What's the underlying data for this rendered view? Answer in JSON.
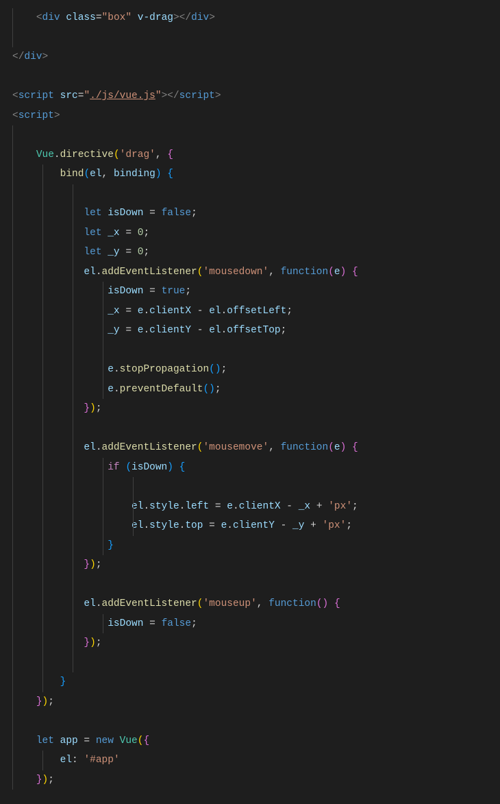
{
  "code": {
    "lines": [
      {
        "indent": 4,
        "guides": [
          0
        ],
        "tokens": [
          [
            "t-punct",
            "<"
          ],
          [
            "t-tag",
            "div"
          ],
          [
            "t-op",
            " "
          ],
          [
            "t-attr",
            "class"
          ],
          [
            "t-op",
            "="
          ],
          [
            "t-string",
            "\"box\""
          ],
          [
            "t-op",
            " "
          ],
          [
            "t-attr",
            "v-drag"
          ],
          [
            "t-punct",
            "></"
          ],
          [
            "t-tag",
            "div"
          ],
          [
            "t-punct",
            ">"
          ]
        ]
      },
      {
        "indent": 0,
        "guides": [
          0
        ],
        "tokens": []
      },
      {
        "indent": 0,
        "guides": [],
        "tokens": [
          [
            "t-punct",
            "</"
          ],
          [
            "t-tag",
            "div"
          ],
          [
            "t-punct",
            ">"
          ]
        ]
      },
      {
        "indent": 0,
        "guides": [],
        "tokens": []
      },
      {
        "indent": 0,
        "guides": [],
        "tokens": [
          [
            "t-punct",
            "<"
          ],
          [
            "t-tag",
            "script"
          ],
          [
            "t-op",
            " "
          ],
          [
            "t-attr",
            "src"
          ],
          [
            "t-op",
            "="
          ],
          [
            "t-string",
            "\""
          ],
          [
            "t-string-u",
            "./js/vue.js"
          ],
          [
            "t-string",
            "\""
          ],
          [
            "t-punct",
            "></"
          ],
          [
            "t-tag",
            "script"
          ],
          [
            "t-punct",
            ">"
          ]
        ]
      },
      {
        "indent": 0,
        "guides": [],
        "tokens": [
          [
            "t-punct",
            "<"
          ],
          [
            "t-tag",
            "script"
          ],
          [
            "t-punct",
            ">"
          ]
        ]
      },
      {
        "indent": 0,
        "guides": [
          0
        ],
        "tokens": []
      },
      {
        "indent": 4,
        "guides": [
          0
        ],
        "tokens": [
          [
            "t-obj",
            "Vue"
          ],
          [
            "t-op",
            "."
          ],
          [
            "t-func",
            "directive"
          ],
          [
            "t-brace-y",
            "("
          ],
          [
            "t-string",
            "'drag'"
          ],
          [
            "t-op",
            ", "
          ],
          [
            "t-brace-p",
            "{"
          ]
        ]
      },
      {
        "indent": 8,
        "guides": [
          0,
          4
        ],
        "tokens": [
          [
            "t-func",
            "bind"
          ],
          [
            "t-brace-b",
            "("
          ],
          [
            "t-var",
            "el"
          ],
          [
            "t-op",
            ", "
          ],
          [
            "t-var",
            "binding"
          ],
          [
            "t-brace-b",
            ")"
          ],
          [
            "t-op",
            " "
          ],
          [
            "t-brace-b",
            "{"
          ]
        ]
      },
      {
        "indent": 0,
        "guides": [
          0,
          4,
          8
        ],
        "tokens": []
      },
      {
        "indent": 12,
        "guides": [
          0,
          4,
          8
        ],
        "tokens": [
          [
            "t-kw",
            "let"
          ],
          [
            "t-op",
            " "
          ],
          [
            "t-var",
            "isDown"
          ],
          [
            "t-op",
            " = "
          ],
          [
            "t-const",
            "false"
          ],
          [
            "t-semi",
            ";"
          ]
        ]
      },
      {
        "indent": 12,
        "guides": [
          0,
          4,
          8
        ],
        "tokens": [
          [
            "t-kw",
            "let"
          ],
          [
            "t-op",
            " "
          ],
          [
            "t-var",
            "_x"
          ],
          [
            "t-op",
            " = "
          ],
          [
            "t-num",
            "0"
          ],
          [
            "t-semi",
            ";"
          ]
        ]
      },
      {
        "indent": 12,
        "guides": [
          0,
          4,
          8
        ],
        "tokens": [
          [
            "t-kw",
            "let"
          ],
          [
            "t-op",
            " "
          ],
          [
            "t-var",
            "_y"
          ],
          [
            "t-op",
            " = "
          ],
          [
            "t-num",
            "0"
          ],
          [
            "t-semi",
            ";"
          ]
        ]
      },
      {
        "indent": 12,
        "guides": [
          0,
          4,
          8
        ],
        "tokens": [
          [
            "t-var",
            "el"
          ],
          [
            "t-op",
            "."
          ],
          [
            "t-func",
            "addEventListener"
          ],
          [
            "t-brace-y",
            "("
          ],
          [
            "t-string",
            "'mousedown'"
          ],
          [
            "t-op",
            ", "
          ],
          [
            "t-kw",
            "function"
          ],
          [
            "t-brace-p",
            "("
          ],
          [
            "t-var",
            "e"
          ],
          [
            "t-brace-p",
            ")"
          ],
          [
            "t-op",
            " "
          ],
          [
            "t-brace-p",
            "{"
          ]
        ]
      },
      {
        "indent": 16,
        "guides": [
          0,
          4,
          8,
          12
        ],
        "tokens": [
          [
            "t-var",
            "isDown"
          ],
          [
            "t-op",
            " = "
          ],
          [
            "t-const",
            "true"
          ],
          [
            "t-semi",
            ";"
          ]
        ]
      },
      {
        "indent": 16,
        "guides": [
          0,
          4,
          8,
          12
        ],
        "tokens": [
          [
            "t-var",
            "_x"
          ],
          [
            "t-op",
            " = "
          ],
          [
            "t-var",
            "e"
          ],
          [
            "t-op",
            "."
          ],
          [
            "t-prop",
            "clientX"
          ],
          [
            "t-op",
            " - "
          ],
          [
            "t-var",
            "el"
          ],
          [
            "t-op",
            "."
          ],
          [
            "t-prop",
            "offsetLeft"
          ],
          [
            "t-semi",
            ";"
          ]
        ]
      },
      {
        "indent": 16,
        "guides": [
          0,
          4,
          8,
          12
        ],
        "tokens": [
          [
            "t-var",
            "_y"
          ],
          [
            "t-op",
            " = "
          ],
          [
            "t-var",
            "e"
          ],
          [
            "t-op",
            "."
          ],
          [
            "t-prop",
            "clientY"
          ],
          [
            "t-op",
            " - "
          ],
          [
            "t-var",
            "el"
          ],
          [
            "t-op",
            "."
          ],
          [
            "t-prop",
            "offsetTop"
          ],
          [
            "t-semi",
            ";"
          ]
        ]
      },
      {
        "indent": 0,
        "guides": [
          0,
          4,
          8,
          12
        ],
        "tokens": []
      },
      {
        "indent": 16,
        "guides": [
          0,
          4,
          8,
          12
        ],
        "tokens": [
          [
            "t-var",
            "e"
          ],
          [
            "t-op",
            "."
          ],
          [
            "t-func",
            "stopPropagation"
          ],
          [
            "t-brace-b",
            "()"
          ],
          [
            "t-semi",
            ";"
          ]
        ]
      },
      {
        "indent": 16,
        "guides": [
          0,
          4,
          8,
          12
        ],
        "tokens": [
          [
            "t-var",
            "e"
          ],
          [
            "t-op",
            "."
          ],
          [
            "t-func",
            "preventDefault"
          ],
          [
            "t-brace-b",
            "()"
          ],
          [
            "t-semi",
            ";"
          ]
        ]
      },
      {
        "indent": 12,
        "guides": [
          0,
          4,
          8
        ],
        "tokens": [
          [
            "t-brace-p",
            "}"
          ],
          [
            "t-brace-y",
            ")"
          ],
          [
            "t-semi",
            ";"
          ]
        ]
      },
      {
        "indent": 0,
        "guides": [
          0,
          4,
          8
        ],
        "tokens": []
      },
      {
        "indent": 12,
        "guides": [
          0,
          4,
          8
        ],
        "tokens": [
          [
            "t-var",
            "el"
          ],
          [
            "t-op",
            "."
          ],
          [
            "t-func",
            "addEventListener"
          ],
          [
            "t-brace-y",
            "("
          ],
          [
            "t-string",
            "'mousemove'"
          ],
          [
            "t-op",
            ", "
          ],
          [
            "t-kw",
            "function"
          ],
          [
            "t-brace-p",
            "("
          ],
          [
            "t-var",
            "e"
          ],
          [
            "t-brace-p",
            ")"
          ],
          [
            "t-op",
            " "
          ],
          [
            "t-brace-p",
            "{"
          ]
        ]
      },
      {
        "indent": 16,
        "guides": [
          0,
          4,
          8,
          12
        ],
        "tokens": [
          [
            "t-kw2",
            "if"
          ],
          [
            "t-op",
            " "
          ],
          [
            "t-brace-b",
            "("
          ],
          [
            "t-var",
            "isDown"
          ],
          [
            "t-brace-b",
            ")"
          ],
          [
            "t-op",
            " "
          ],
          [
            "t-brace-b",
            "{"
          ]
        ]
      },
      {
        "indent": 0,
        "guides": [
          0,
          4,
          8,
          12,
          16
        ],
        "tokens": []
      },
      {
        "indent": 20,
        "guides": [
          0,
          4,
          8,
          12,
          16
        ],
        "tokens": [
          [
            "t-var",
            "el"
          ],
          [
            "t-op",
            "."
          ],
          [
            "t-prop",
            "style"
          ],
          [
            "t-op",
            "."
          ],
          [
            "t-prop",
            "left"
          ],
          [
            "t-op",
            " = "
          ],
          [
            "t-var",
            "e"
          ],
          [
            "t-op",
            "."
          ],
          [
            "t-prop",
            "clientX"
          ],
          [
            "t-op",
            " - "
          ],
          [
            "t-var",
            "_x"
          ],
          [
            "t-op",
            " + "
          ],
          [
            "t-string",
            "'px'"
          ],
          [
            "t-semi",
            ";"
          ]
        ]
      },
      {
        "indent": 20,
        "guides": [
          0,
          4,
          8,
          12,
          16
        ],
        "tokens": [
          [
            "t-var",
            "el"
          ],
          [
            "t-op",
            "."
          ],
          [
            "t-prop",
            "style"
          ],
          [
            "t-op",
            "."
          ],
          [
            "t-prop",
            "top"
          ],
          [
            "t-op",
            " = "
          ],
          [
            "t-var",
            "e"
          ],
          [
            "t-op",
            "."
          ],
          [
            "t-prop",
            "clientY"
          ],
          [
            "t-op",
            " - "
          ],
          [
            "t-var",
            "_y"
          ],
          [
            "t-op",
            " + "
          ],
          [
            "t-string",
            "'px'"
          ],
          [
            "t-semi",
            ";"
          ]
        ]
      },
      {
        "indent": 16,
        "guides": [
          0,
          4,
          8,
          12
        ],
        "tokens": [
          [
            "t-brace-b",
            "}"
          ]
        ]
      },
      {
        "indent": 12,
        "guides": [
          0,
          4,
          8
        ],
        "tokens": [
          [
            "t-brace-p",
            "}"
          ],
          [
            "t-brace-y",
            ")"
          ],
          [
            "t-semi",
            ";"
          ]
        ]
      },
      {
        "indent": 0,
        "guides": [
          0,
          4,
          8
        ],
        "tokens": []
      },
      {
        "indent": 12,
        "guides": [
          0,
          4,
          8
        ],
        "tokens": [
          [
            "t-var",
            "el"
          ],
          [
            "t-op",
            "."
          ],
          [
            "t-func",
            "addEventListener"
          ],
          [
            "t-brace-y",
            "("
          ],
          [
            "t-string",
            "'mouseup'"
          ],
          [
            "t-op",
            ", "
          ],
          [
            "t-kw",
            "function"
          ],
          [
            "t-brace-p",
            "()"
          ],
          [
            "t-op",
            " "
          ],
          [
            "t-brace-p",
            "{"
          ]
        ]
      },
      {
        "indent": 16,
        "guides": [
          0,
          4,
          8,
          12
        ],
        "tokens": [
          [
            "t-var",
            "isDown"
          ],
          [
            "t-op",
            " = "
          ],
          [
            "t-const",
            "false"
          ],
          [
            "t-semi",
            ";"
          ]
        ]
      },
      {
        "indent": 12,
        "guides": [
          0,
          4,
          8
        ],
        "tokens": [
          [
            "t-brace-p",
            "}"
          ],
          [
            "t-brace-y",
            ")"
          ],
          [
            "t-semi",
            ";"
          ]
        ]
      },
      {
        "indent": 0,
        "guides": [
          0,
          4,
          8
        ],
        "tokens": []
      },
      {
        "indent": 8,
        "guides": [
          0,
          4
        ],
        "tokens": [
          [
            "t-brace-b",
            "}"
          ]
        ]
      },
      {
        "indent": 4,
        "guides": [
          0
        ],
        "tokens": [
          [
            "t-brace-p",
            "}"
          ],
          [
            "t-brace-y",
            ")"
          ],
          [
            "t-semi",
            ";"
          ]
        ]
      },
      {
        "indent": 0,
        "guides": [
          0
        ],
        "tokens": []
      },
      {
        "indent": 4,
        "guides": [
          0
        ],
        "tokens": [
          [
            "t-kw",
            "let"
          ],
          [
            "t-op",
            " "
          ],
          [
            "t-var",
            "app"
          ],
          [
            "t-op",
            " = "
          ],
          [
            "t-kw",
            "new"
          ],
          [
            "t-op",
            " "
          ],
          [
            "t-obj",
            "Vue"
          ],
          [
            "t-brace-y",
            "("
          ],
          [
            "t-brace-p",
            "{"
          ]
        ]
      },
      {
        "indent": 8,
        "guides": [
          0,
          4
        ],
        "tokens": [
          [
            "t-prop",
            "el"
          ],
          [
            "t-op",
            ": "
          ],
          [
            "t-string",
            "'#app'"
          ]
        ]
      },
      {
        "indent": 4,
        "guides": [
          0
        ],
        "tokens": [
          [
            "t-brace-p",
            "}"
          ],
          [
            "t-brace-y",
            ")"
          ],
          [
            "t-semi",
            ";"
          ]
        ]
      }
    ]
  },
  "charWidth": 11.0
}
